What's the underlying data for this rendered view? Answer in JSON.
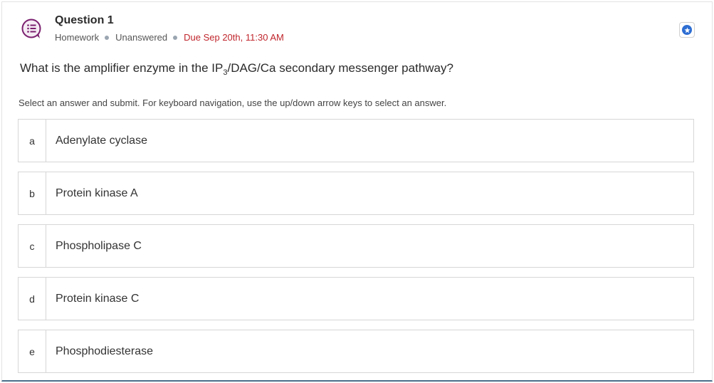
{
  "question": {
    "title": "Question 1",
    "type": "Homework",
    "status": "Unanswered",
    "due": "Due Sep 20th, 11:30 AM",
    "prompt_before": "What is the amplifier enzyme in the IP",
    "prompt_sub": "3",
    "prompt_after": "/DAG/Ca secondary messenger pathway?",
    "instructions": "Select an answer and submit. For keyboard navigation, use the up/down arrow keys to select an answer."
  },
  "icons": {
    "question_icon": "question-list-icon",
    "favorite_icon": "star-icon"
  },
  "colors": {
    "icon_purple": "#7a1f6e",
    "due_red": "#c0262d",
    "star_blue": "#2d6dd2",
    "bottom_border": "#4a6e8a"
  },
  "options": [
    {
      "letter": "a",
      "text": "Adenylate cyclase"
    },
    {
      "letter": "b",
      "text": "Protein kinase A"
    },
    {
      "letter": "c",
      "text": "Phospholipase C"
    },
    {
      "letter": "d",
      "text": "Protein kinase C"
    },
    {
      "letter": "e",
      "text": "Phosphodiesterase"
    }
  ]
}
